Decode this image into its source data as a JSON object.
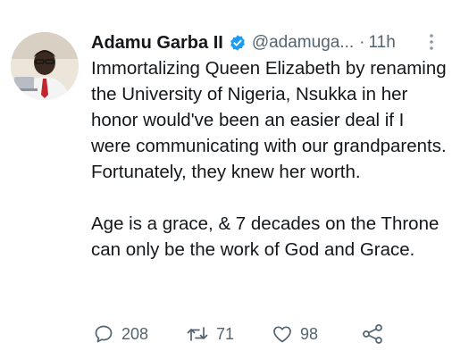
{
  "tweet": {
    "author": {
      "display_name": "Adamu Garba II",
      "handle": "@adamuga...",
      "verified": true,
      "avatar_icon": "profile-photo"
    },
    "timestamp": "11h",
    "separator": "·",
    "body": {
      "paragraph1": "Immortalizing Queen Elizabeth by renaming the University of Nigeria, Nsukka in her honor would've been an easier deal if I were communicating with our grandparents. Fortunately, they knew her worth.",
      "paragraph2": "Age is a grace, & 7 decades on the Throne can only be the work of God and Grace."
    },
    "actions": {
      "reply_count": "208",
      "retweet_count": "71",
      "like_count": "98",
      "share_icon": "share-icon"
    },
    "colors": {
      "text": "#14171a",
      "muted": "#536471",
      "verified_badge": "#1d9bf0"
    }
  }
}
